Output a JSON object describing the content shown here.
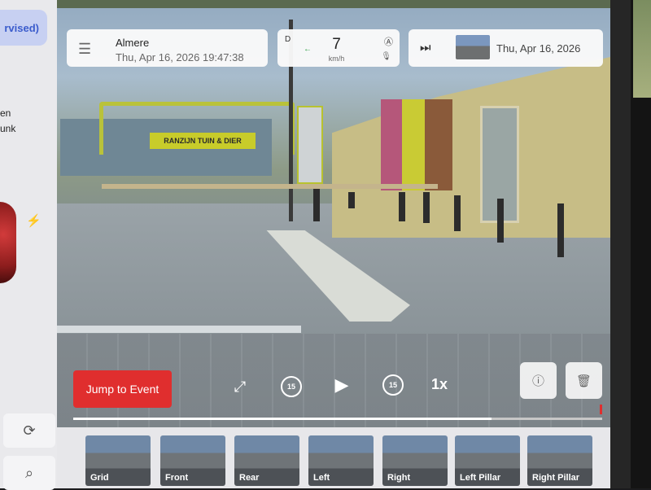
{
  "left_panel": {
    "supervised_text": "rvised)",
    "side_text_line1": "en",
    "side_text_line2": "unk",
    "bolt_icon": "⚡",
    "sync_icon": "⟳",
    "search_icon": "⌕"
  },
  "hud": {
    "menu_icon": "☰",
    "location_name": "Almere",
    "location_datetime": "Thu, Apr 16, 2026 19:47:38",
    "gear": "D",
    "direction_arrow": "←",
    "speed": "7",
    "speed_unit": "km/h",
    "autopilot_icon": "Ⓐ",
    "mic_icon": "🎙",
    "skip_icon": "⏭",
    "event_date": "Thu, Apr 16, 2026"
  },
  "scene": {
    "store_sign": "RANZIJN   TUIN & DIER"
  },
  "controls": {
    "jump_label": "Jump to Event",
    "fullscreen_icon": "⤢",
    "rewind_label": "15",
    "play_icon": "▶",
    "forward_label": "15",
    "speed_label": "1x",
    "info_icon": "ⓘ",
    "delete_icon": "🗑",
    "progress_fraction": 0.79
  },
  "cameras": [
    {
      "label": "Grid"
    },
    {
      "label": "Front"
    },
    {
      "label": "Rear"
    },
    {
      "label": "Left"
    },
    {
      "label": "Right"
    },
    {
      "label": "Left Pillar"
    },
    {
      "label": "Right Pillar"
    }
  ]
}
